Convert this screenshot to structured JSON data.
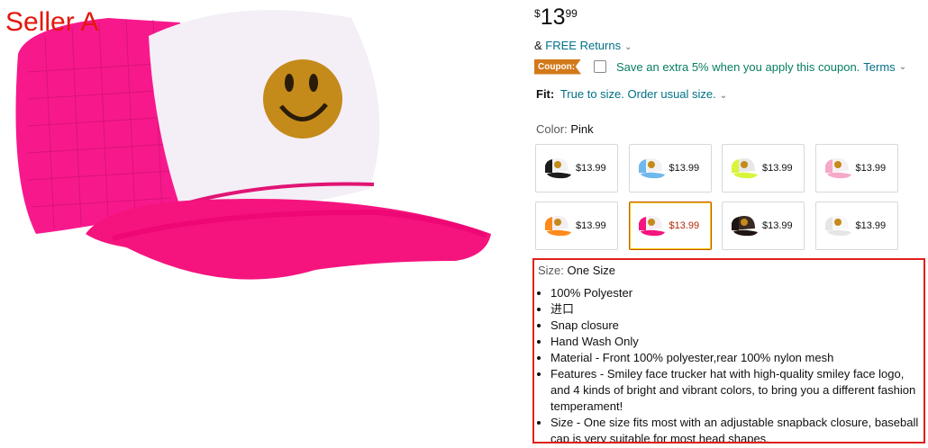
{
  "seller_label": "Seller A",
  "price": {
    "symbol": "$",
    "whole": "13",
    "fraction": "99"
  },
  "returns": {
    "prefix": "&",
    "link": "FREE Returns"
  },
  "coupon": {
    "badge": "Coupon:",
    "text": "Save an extra 5% when you apply this coupon.",
    "terms": "Terms"
  },
  "fit": {
    "label": "Fit:",
    "value": "True to size. Order usual size."
  },
  "color": {
    "label": "Color:",
    "value": "Pink"
  },
  "swatches": [
    {
      "price": "$13.99",
      "color": "black",
      "selected": false
    },
    {
      "price": "$13.99",
      "color": "blue",
      "selected": false
    },
    {
      "price": "$13.99",
      "color": "neon-yellow",
      "selected": false
    },
    {
      "price": "$13.99",
      "color": "light-pink",
      "selected": false
    },
    {
      "price": "$13.99",
      "color": "orange",
      "selected": false
    },
    {
      "price": "$13.99",
      "color": "pink",
      "selected": true
    },
    {
      "price": "$13.99",
      "color": "brown",
      "selected": false
    },
    {
      "price": "$13.99",
      "color": "white",
      "selected": false
    }
  ],
  "size": {
    "label": "Size:",
    "value": "One Size"
  },
  "bullets": [
    "100% Polyester",
    "进口",
    "Snap closure",
    "Hand Wash Only",
    "Material - Front 100% polyester,rear 100% nylon mesh",
    "Features - Smiley face trucker hat with high-quality smiley face logo, and 4 kinds of bright and vibrant colors, to bring you a different fashion temperament!",
    "Size - One size fits most with an adjustable snapback closure, baseball cap is very suitable for most head shapes."
  ],
  "colors": {
    "accent_link": "#007185",
    "coupon": "#d3791a",
    "highlight_box": "#e0201b",
    "cap_pink": "#f5147e"
  }
}
